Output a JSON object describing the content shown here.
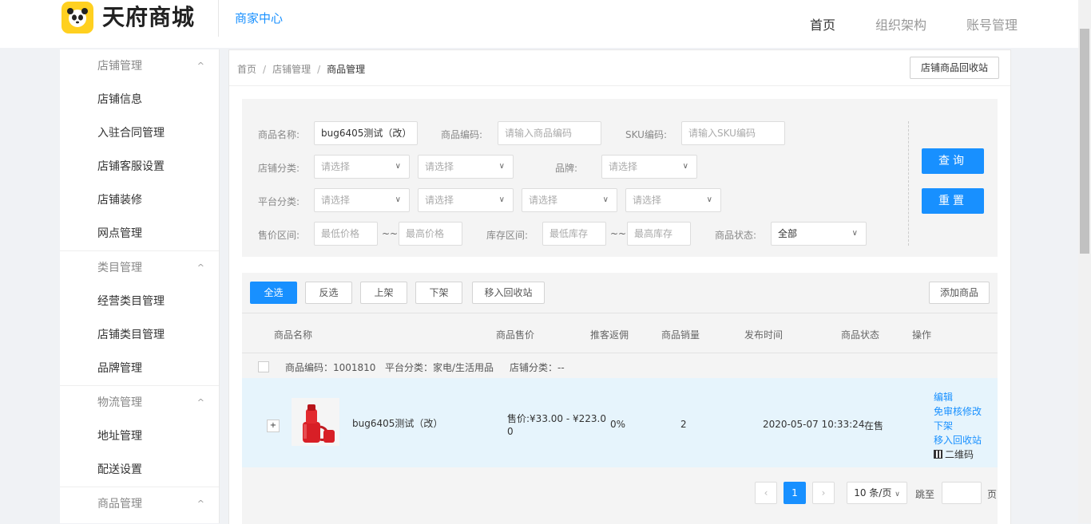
{
  "header": {
    "logo_text": "天府商城",
    "merchant_center": "商家中心",
    "nav": [
      "首页",
      "组织架构",
      "账号管理"
    ]
  },
  "sidebar": {
    "groups": [
      {
        "title": "店铺管理",
        "items": [
          "店铺信息",
          "入驻合同管理",
          "店铺客服设置",
          "店铺装修",
          "网点管理"
        ]
      },
      {
        "title": "类目管理",
        "items": [
          "经营类目管理",
          "店铺类目管理",
          "品牌管理"
        ]
      },
      {
        "title": "物流管理",
        "items": [
          "地址管理",
          "配送设置"
        ]
      },
      {
        "title": "商品管理",
        "items": []
      }
    ]
  },
  "breadcrumb": [
    "首页",
    "店铺管理",
    "商品管理"
  ],
  "recycle_button": "店铺商品回收站",
  "filter": {
    "name_label": "商品名称:",
    "name_value": "bug6405测试（改）",
    "code_label": "商品编码:",
    "code_placeholder": "请输入商品编码",
    "sku_label": "SKU编码:",
    "sku_placeholder": "请输入SKU编码",
    "shop_cat_label": "店铺分类:",
    "brand_label": "品牌:",
    "platform_cat_label": "平台分类:",
    "select_placeholder": "请选择",
    "price_label": "售价区间:",
    "price_min": "最低价格",
    "price_max": "最高价格",
    "stock_label": "库存区间:",
    "stock_min": "最低库存",
    "stock_max": "最高库存",
    "range_sep": "~~",
    "status_label": "商品状态:",
    "status_value": "全部",
    "query_button": "查询",
    "reset_button": "重置"
  },
  "toolbar": {
    "select_all": "全选",
    "invert": "反选",
    "on_shelf": "上架",
    "off_shelf": "下架",
    "move_recycle": "移入回收站",
    "add_product": "添加商品"
  },
  "table": {
    "headers": [
      "商品名称",
      "商品售价",
      "推客返佣",
      "商品销量",
      "发布时间",
      "商品状态",
      "操作"
    ],
    "rows": [
      {
        "code": "商品编码：1001810",
        "platform_category": "平台分类：家电/生活用品",
        "shop_category": "店铺分类：--",
        "name": "bug6405测试（改）",
        "price_line1": "售价:¥33.00 - ¥223.0",
        "price_line2": "0",
        "commission": "0%",
        "sales": "2",
        "publish_time": "2020-05-07 10:33:24",
        "status": "在售",
        "ops": [
          "编辑",
          "免审核修改",
          "下架",
          "移入回收站"
        ],
        "qr_label": "二维码"
      }
    ]
  },
  "pagination": {
    "prev": "‹",
    "current": "1",
    "next": "›",
    "page_size": "10 条/页",
    "goto": "跳至",
    "page_unit": "页"
  },
  "colors": {
    "accent": "#1890ff",
    "row_highlight": "#e6f4fc",
    "logo_yellow": "#ffd020"
  }
}
